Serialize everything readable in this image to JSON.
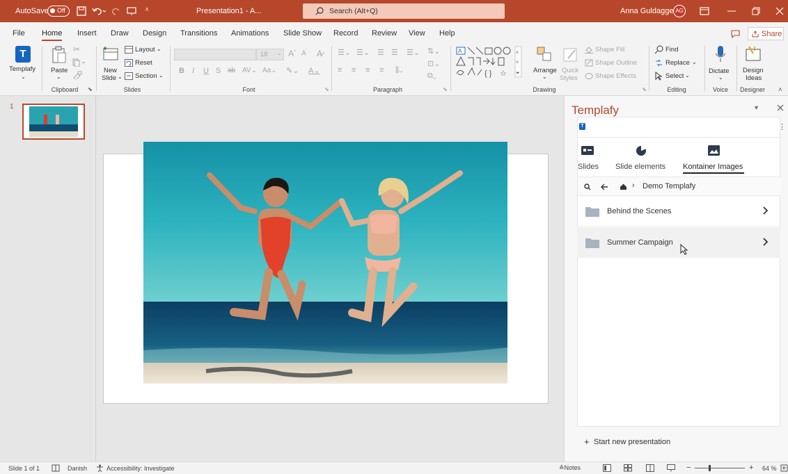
{
  "titlebar": {
    "autosave_label": "AutoSave",
    "autosave_state": "Off",
    "doc_title": "Presentation1 - A...",
    "search_placeholder": "Search (Alt+Q)",
    "user_name": "Anna Guldagger",
    "user_initials": "AG"
  },
  "tabs": [
    "File",
    "Home",
    "Insert",
    "Draw",
    "Design",
    "Transitions",
    "Animations",
    "Slide Show",
    "Record",
    "Review",
    "View",
    "Help"
  ],
  "share_label": "Share",
  "ribbon": {
    "templafy_label": "Templafy",
    "paste_label": "Paste",
    "clipboard_group": "Clipboard",
    "new_slide_label1": "New",
    "new_slide_label2": "Slide",
    "layout_label": "Layout",
    "reset_label": "Reset",
    "section_label": "Section",
    "slides_group": "Slides",
    "font_size": "18",
    "font_group": "Font",
    "paragraph_group": "Paragraph",
    "arrange_label": "Arrange",
    "quick_styles_label1": "Quick",
    "quick_styles_label2": "Styles",
    "shape_fill_label": "Shape Fill",
    "shape_outline_label": "Shape Outline",
    "shape_effects_label": "Shape Effects",
    "drawing_group": "Drawing",
    "find_label": "Find",
    "replace_label": "Replace",
    "select_label": "Select",
    "editing_group": "Editing",
    "dictate_label": "Dictate",
    "voice_group": "Voice",
    "design_ideas_label1": "Design",
    "design_ideas_label2": "Ideas",
    "designer_group": "Designer"
  },
  "slides_panel": {
    "slide_number": "1"
  },
  "taskpane": {
    "title": "Templafy",
    "tabs": [
      "Slides",
      "Slide elements",
      "Kontainer Images"
    ],
    "active_tab": "Kontainer Images",
    "breadcrumb": "Demo Templafy",
    "folders": [
      {
        "name": "Behind the Scenes"
      },
      {
        "name": "Summer Campaign"
      }
    ],
    "start_new": "Start new presentation"
  },
  "statusbar": {
    "slide_info": "Slide 1 of 1",
    "language": "Danish",
    "accessibility": "Accessibility: Investigate",
    "notes": "Notes",
    "zoom": "64 %"
  },
  "colors": {
    "accent": "#b7472a",
    "templafy_blue": "#1565c0",
    "avatar": "#c0392b",
    "search_box": "#f5c9b9"
  }
}
